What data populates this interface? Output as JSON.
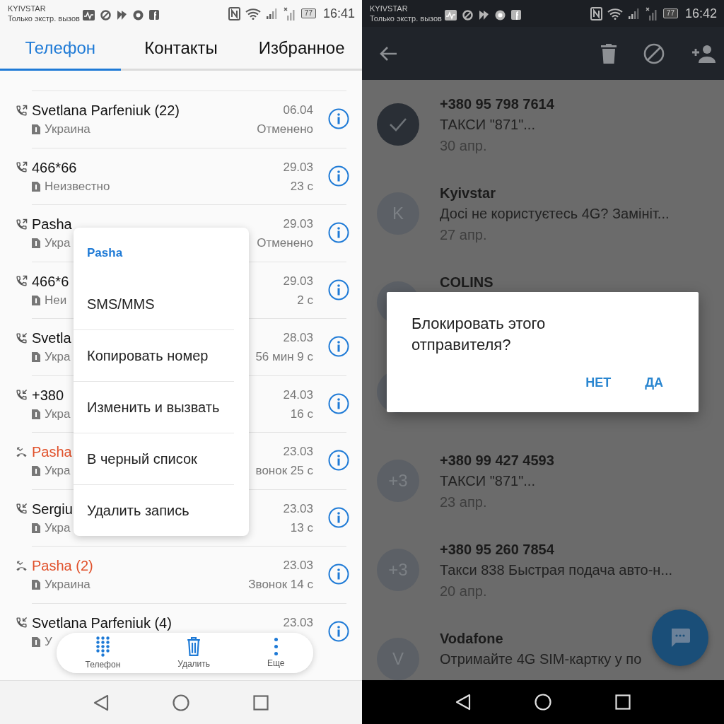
{
  "phone_screen": {
    "status_bar": {
      "carrier": "KYIVSTAR",
      "network_status": "Только экстр. вызов",
      "battery": "77",
      "time": "16:41"
    },
    "tabs": [
      {
        "label": "Телефон",
        "selected": true
      },
      {
        "label": "Контакты",
        "selected": false
      },
      {
        "label": "Избранное",
        "selected": false
      }
    ],
    "call_log": [
      {
        "kind": "outgoing",
        "name": "Svetlana Parfeniuk (22)",
        "date": "06.04",
        "location": "Украина",
        "detail": "Отменено"
      },
      {
        "kind": "outgoing",
        "name": "466*66",
        "date": "29.03",
        "location": "Неизвестно",
        "detail": "23 с"
      },
      {
        "kind": "outgoing",
        "name": "Pasha",
        "date": "29.03",
        "location": "Укра",
        "detail": "Отменено"
      },
      {
        "kind": "outgoing",
        "name": "466*6",
        "date": "29.03",
        "location": "Неи",
        "detail": "2 с"
      },
      {
        "kind": "incoming",
        "name": "Svetla",
        "date": "28.03",
        "location": "Укра",
        "detail": "56 мин 9 с"
      },
      {
        "kind": "incoming",
        "name": "+380",
        "date": "24.03",
        "location": "Укра",
        "detail": "16 с"
      },
      {
        "kind": "missed",
        "name": "Pasha",
        "date": "23.03",
        "location": "Укра",
        "detail": "вонок 25 с"
      },
      {
        "kind": "incoming",
        "name": "Sergiu",
        "date": "23.03",
        "location": "Укра",
        "detail": "13 с"
      },
      {
        "kind": "missed",
        "name": "Pasha (2)",
        "date": "23.03",
        "location": "Украина",
        "detail": "Звонок 14 с"
      },
      {
        "kind": "incoming",
        "name": "Svetlana Parfeniuk (4)",
        "date": "23.03",
        "location": "У"
      }
    ],
    "context_menu": {
      "title": "Pasha",
      "items": [
        "SMS/MMS",
        "Копировать номер",
        "Изменить и вызвать",
        "В черный список",
        "Удалить запись"
      ]
    },
    "action_bar": [
      {
        "kind": "dialpad",
        "label": "Телефон"
      },
      {
        "kind": "delete",
        "label": "Удалить"
      },
      {
        "kind": "more",
        "label": "Еще"
      }
    ]
  },
  "messages_screen": {
    "status_bar": {
      "carrier": "KYIVSTAR",
      "network_status": "Только экстр. вызов",
      "battery": "77",
      "time": "16:42"
    },
    "conversations": [
      {
        "selected": true,
        "sender": "+380 95 798 7614",
        "snippet": "ТАКСИ \"871\"...",
        "date": "30 апр."
      },
      {
        "selected": false,
        "avatar": "K",
        "sender": "Kyivstar",
        "snippet": "Досі не користуєтесь 4G? Замініт...",
        "date": "27 апр."
      },
      {
        "selected": false,
        "sender": "COLINS"
      },
      {
        "selected": false
      },
      {
        "selected": false,
        "avatar": "+3",
        "sender": "+380 99 427 4593",
        "snippet": "ТАКСИ \"871\"...",
        "date": "23 апр."
      },
      {
        "selected": false,
        "avatar": "+3",
        "sender": "+380 95 260 7854",
        "snippet": "Такси 838 Быстрая подача авто-н...",
        "date": "20 апр."
      },
      {
        "selected": false,
        "avatar": "V",
        "sender": "Vodafone",
        "snippet": "Отримайте 4G SIM-картку у по"
      }
    ],
    "dialog": {
      "message": "Блокировать этого отправителя?",
      "buttons": [
        "НЕТ",
        "ДА"
      ]
    }
  }
}
